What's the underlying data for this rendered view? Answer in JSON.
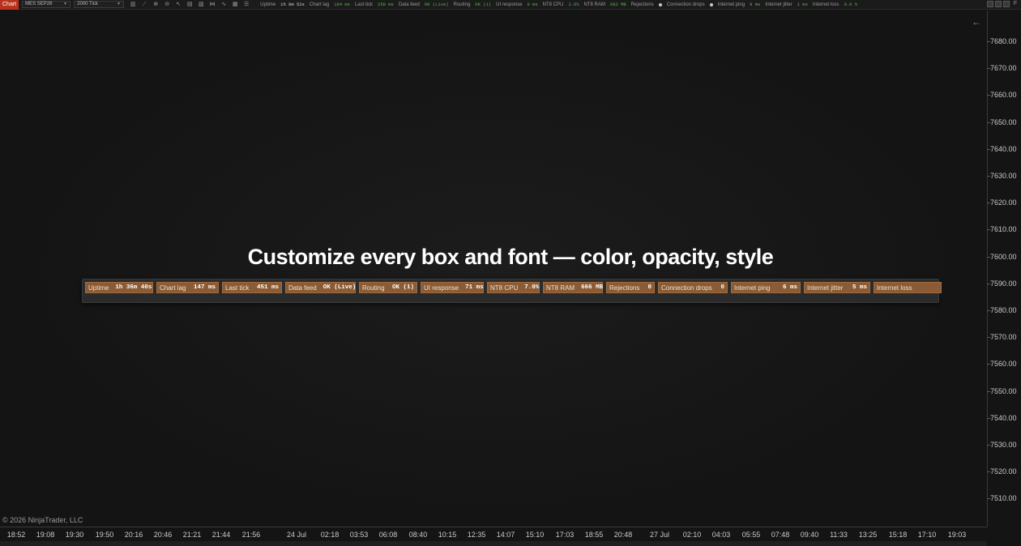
{
  "toolbar": {
    "tab_label": "Chart",
    "instrument": "MES SEP26",
    "interval": "2000 Tick",
    "tools": [
      "bars-icon",
      "draw-line-icon",
      "zoom-in-icon",
      "zoom-out-icon",
      "pointer-icon",
      "data-box-icon",
      "templates-icon",
      "strategies-icon",
      "indicators-icon",
      "properties-icon",
      "list-icon"
    ],
    "status": [
      {
        "label": "Uptime",
        "value": "1h 0m 52s",
        "white": true
      },
      {
        "label": "Chart lag",
        "value": "194 ms"
      },
      {
        "label": "Last tick",
        "value": "258 ms"
      },
      {
        "label": "Data feed",
        "value": "OK (Live)"
      },
      {
        "label": "Routing",
        "value": "OK (1)"
      },
      {
        "label": "UI response",
        "value": "0 ms"
      },
      {
        "label": "NT8 CPU",
        "value": "1.6%"
      },
      {
        "label": "NT8 RAM",
        "value": "682 MB"
      },
      {
        "label": "Rejections",
        "value": ""
      },
      {
        "label": "Connection drops",
        "value": ""
      },
      {
        "label": "Internet ping",
        "value": "9 ms"
      },
      {
        "label": "Internet jitter",
        "value": "1 ms"
      },
      {
        "label": "Internet loss",
        "value": "0.0 %"
      }
    ],
    "float_label": "F"
  },
  "headline": "Customize every box and font — color, opacity, style",
  "metrics": [
    {
      "label": "Uptime",
      "value": "1h 36m 40s"
    },
    {
      "label": "Chart lag",
      "value": "147 ms"
    },
    {
      "label": "Last tick",
      "value": "451 ms"
    },
    {
      "label": "Data feed",
      "value": "OK (Live)"
    },
    {
      "label": "Routing",
      "value": "OK (1)"
    },
    {
      "label": "UI response",
      "value": "71 ms"
    },
    {
      "label": "NT8 CPU",
      "value": "7.0%"
    },
    {
      "label": "NT8 RAM",
      "value": "666 MB"
    },
    {
      "label": "Rejections",
      "value": "0"
    },
    {
      "label": "Connection drops",
      "value": "0"
    },
    {
      "label": "Internet ping",
      "value": "6 ms"
    },
    {
      "label": "Internet jitter",
      "value": "5 ms"
    },
    {
      "label": "Internet loss",
      "value": ""
    }
  ],
  "y_axis": [
    "7680.00",
    "7670.00",
    "7660.00",
    "7650.00",
    "7640.00",
    "7630.00",
    "7620.00",
    "7610.00",
    "7600.00",
    "7590.00",
    "7580.00",
    "7570.00",
    "7560.00",
    "7550.00",
    "7540.00",
    "7530.00",
    "7520.00",
    "7510.00"
  ],
  "x_axis": [
    "18:52",
    "19:08",
    "19:30",
    "19:50",
    "20:16",
    "20:46",
    "21:21",
    "21:44",
    "21:56",
    "24 Jul",
    "02:18",
    "03:53",
    "06:08",
    "08:40",
    "10:15",
    "12:35",
    "14:07",
    "15:10",
    "17:03",
    "18:55",
    "20:48",
    "27 Jul",
    "02:10",
    "04:03",
    "05:55",
    "07:48",
    "09:40",
    "11:33",
    "13:25",
    "15:18",
    "17:10",
    "19:03"
  ],
  "copyright": "© 2026 NinjaTrader, LLC",
  "colors": {
    "box_fill": "#8a5b34",
    "tab_accent": "#b8321c",
    "status_green": "#55b84a"
  }
}
